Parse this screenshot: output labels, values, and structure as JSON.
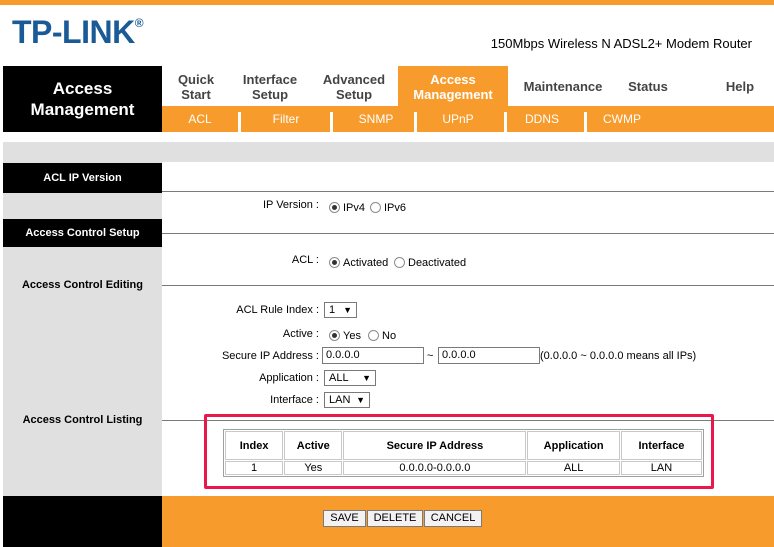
{
  "header": {
    "logo": "TP-LINK",
    "logo_mark": "®",
    "model": "150Mbps Wireless N ADSL2+ Modem Router"
  },
  "nav": {
    "section_title_line1": "Access",
    "section_title_line2": "Management",
    "tabs": [
      {
        "line1": "Quick",
        "line2": "Start"
      },
      {
        "line1": "Interface",
        "line2": "Setup"
      },
      {
        "line1": "Advanced",
        "line2": "Setup"
      },
      {
        "line1": "Access",
        "line2": "Management"
      },
      {
        "line1": "Maintenance",
        "line2": ""
      },
      {
        "line1": "Status",
        "line2": ""
      },
      {
        "line1": "Help",
        "line2": ""
      }
    ],
    "active_tab": "Access Management",
    "subtabs": [
      "ACL",
      "Filter",
      "SNMP",
      "UPnP",
      "DDNS",
      "CWMP"
    ]
  },
  "sections": {
    "acl_ip_version": "ACL IP Version",
    "access_control_setup": "Access Control Setup",
    "access_control_editing": "Access Control Editing",
    "access_control_listing": "Access Control Listing"
  },
  "form": {
    "ip_version_label": "IP Version :",
    "ip_version_options": [
      "IPv4",
      "IPv6"
    ],
    "ip_version_selected": "IPv4",
    "acl_label": "ACL :",
    "acl_options": [
      "Activated",
      "Deactivated"
    ],
    "acl_selected": "Activated",
    "rule_index_label": "ACL Rule Index :",
    "rule_index_value": "1",
    "active_label": "Active :",
    "active_options": [
      "Yes",
      "No"
    ],
    "active_selected": "Yes",
    "secure_ip_label": "Secure IP Address :",
    "secure_ip_start": "0.0.0.0",
    "secure_ip_separator": "~",
    "secure_ip_end": "0.0.0.0",
    "secure_ip_note": "(0.0.0.0 ~ 0.0.0.0 means all IPs)",
    "application_label": "Application :",
    "application_value": "ALL",
    "interface_label": "Interface :",
    "interface_value": "LAN"
  },
  "listing": {
    "headers": [
      "Index",
      "Active",
      "Secure IP Address",
      "Application",
      "Interface"
    ],
    "rows": [
      [
        "1",
        "Yes",
        "0.0.0.0-0.0.0.0",
        "ALL",
        "LAN"
      ]
    ]
  },
  "buttons": {
    "save": "SAVE",
    "delete": "DELETE",
    "cancel": "CANCEL"
  },
  "colors": {
    "brand_orange": "#f79b2c",
    "logo_blue": "#1a5a96",
    "highlight_red": "#e8184a"
  }
}
